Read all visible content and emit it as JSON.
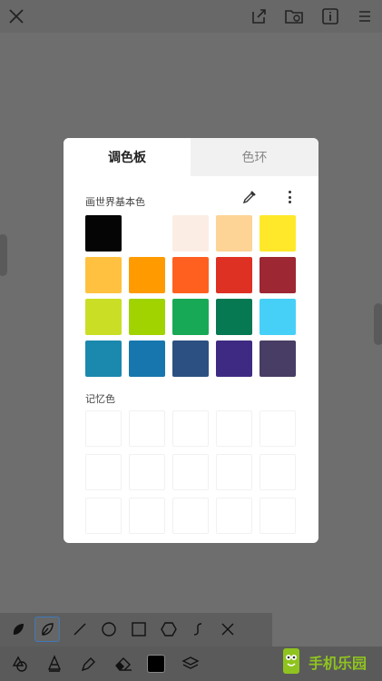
{
  "topbar": {
    "icons": [
      "close-icon",
      "share-icon",
      "folder-icon",
      "info-icon",
      "menu-icon"
    ]
  },
  "dialog": {
    "tabs": [
      {
        "label": "调色板",
        "active": true
      },
      {
        "label": "色环",
        "active": false
      }
    ],
    "palette_label": "画世界基本色",
    "memory_label": "记忆色",
    "palette_colors": [
      "#050505",
      "#ffffff",
      "#fcede4",
      "#fed396",
      "#ffe82a",
      "#ffc13f",
      "#ff9b00",
      "#ff6020",
      "#de3023",
      "#9d2732",
      "#cade25",
      "#a1d300",
      "#17a955",
      "#067852",
      "#47d0f7",
      "#1b88ad",
      "#1676ad",
      "#2c5081",
      "#3e2a83",
      "#483d64"
    ]
  },
  "toolbar": {
    "row1": [
      "leaf-brush-icon",
      "lasso-icon",
      "line-icon",
      "circle-icon",
      "rectangle-icon",
      "hexagon-icon",
      "curve-icon",
      "close-icon"
    ],
    "row2": [
      "shapes-icon",
      "pen-nib-icon",
      "pipette-icon",
      "eraser-icon",
      "color-square-icon",
      "layers-icon"
    ],
    "current_color": "#000000"
  },
  "brand": {
    "text": "手机乐园"
  }
}
